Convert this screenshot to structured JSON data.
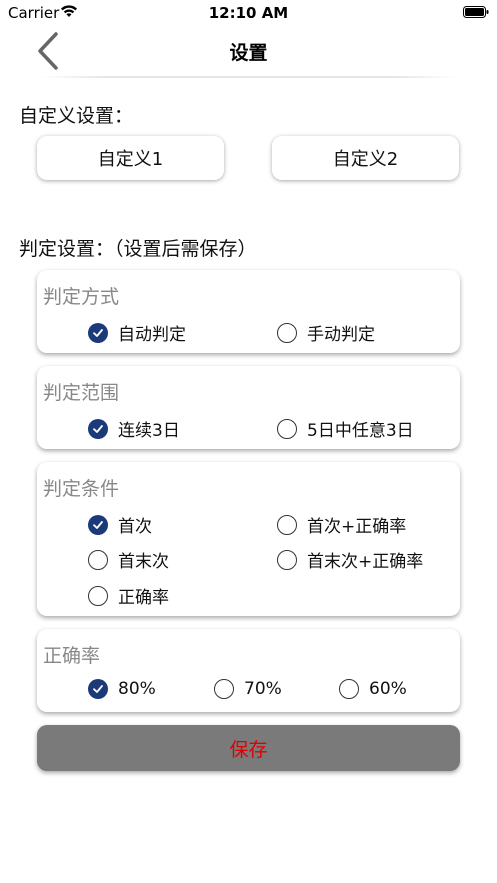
{
  "status_bar": {
    "carrier": "Carrier",
    "time": "12:10 AM"
  },
  "nav": {
    "title": "设置"
  },
  "custom_section": {
    "label": "自定义设置：",
    "buttons": [
      "自定义1",
      "自定义2"
    ]
  },
  "judge_section": {
    "label": "判定设置：（设置后需保存）"
  },
  "cards": [
    {
      "title": "判定方式",
      "options": [
        {
          "label": "自动判定",
          "checked": true
        },
        {
          "label": "手动判定",
          "checked": false
        }
      ]
    },
    {
      "title": "判定范围",
      "options": [
        {
          "label": "连续3日",
          "checked": true
        },
        {
          "label": "5日中任意3日",
          "checked": false
        }
      ]
    },
    {
      "title": "判定条件",
      "options": [
        {
          "label": "首次",
          "checked": true
        },
        {
          "label": "首次+正确率",
          "checked": false
        },
        {
          "label": "首末次",
          "checked": false
        },
        {
          "label": "首末次+正确率",
          "checked": false
        },
        {
          "label": "正确率",
          "checked": false
        }
      ]
    },
    {
      "title": "正确率",
      "options": [
        {
          "label": "80%",
          "checked": true
        },
        {
          "label": "70%",
          "checked": false
        },
        {
          "label": "60%",
          "checked": false
        }
      ]
    }
  ],
  "save_button": {
    "label": "保存"
  },
  "colors": {
    "accent": "#1b3a7a",
    "save_bg": "#7a7a7a",
    "save_text": "#e00000",
    "card_title": "#888888"
  }
}
